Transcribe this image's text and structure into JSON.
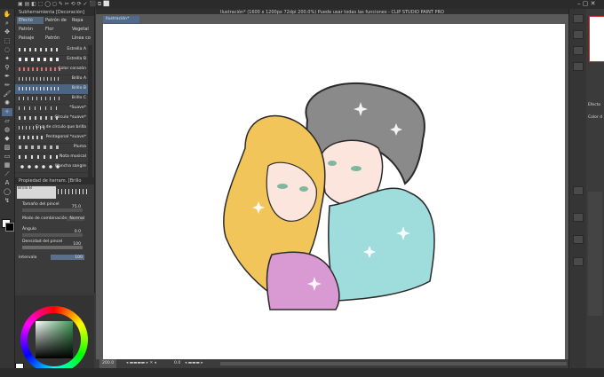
{
  "window": {
    "title": "Ilustración* (1600 x 1200px 72dpi 200.0%)  Puede usar todas las funciones - CLIP STUDIO PAINT PRO",
    "document_tab": "Ilustración*"
  },
  "sub_tool_panel": {
    "title": "Subherramienta [Decoración]",
    "tabs": [
      "Efecto",
      "Patrón de",
      "Ropa",
      "Patrón",
      "Flor",
      "Vegetal",
      "Paisaje",
      "Patrón",
      "Línea co"
    ],
    "brushes": [
      {
        "name": "Estrella A",
        "selected": false
      },
      {
        "name": "Estrella B",
        "selected": false
      },
      {
        "name": "Color corazón",
        "selected": false
      },
      {
        "name": "Brillo A",
        "selected": false
      },
      {
        "name": "Brillo B",
        "selected": true
      },
      {
        "name": "Brillo C",
        "selected": false
      },
      {
        "name": "*Suave*",
        "selected": false
      },
      {
        "name": "Círculo *suave*",
        "selected": false
      },
      {
        "name": "Cruz de círculo que brilla",
        "selected": false
      },
      {
        "name": "Pentagonal *suave*",
        "selected": false
      },
      {
        "name": "Pluma",
        "selected": false
      },
      {
        "name": "Nota musical",
        "selected": false
      },
      {
        "name": "Mancha sangre",
        "selected": false
      }
    ]
  },
  "tool_property": {
    "title": "Propiedad de herram. [Brillo",
    "preview_label": "Brillo B",
    "brush_size_label": "Tamaño del pincel",
    "brush_size_value": "75.0",
    "blend_mode_label": "Modo de combinación",
    "blend_mode_value": "Normal",
    "angle_label": "Ángulo",
    "angle_value": "0.0",
    "density_label": "Densidad del pincel",
    "density_value": "100",
    "interval_label": "Intervalo",
    "interval_value": "100"
  },
  "status": {
    "zoom": "200.0",
    "rotation": "0.0"
  },
  "right_panel": {
    "label_effect": "Efecto",
    "label_color": "Color d"
  },
  "colors": {
    "accent": "#4f6a8c",
    "main_color": "#ffffff",
    "sub_color": "#000000",
    "picker_green": "#3f9a58"
  },
  "icons": [
    "brush-icon",
    "pen-icon",
    "eraser-icon",
    "fill-icon",
    "move-icon",
    "zoom-icon",
    "hand-icon",
    "text-icon",
    "eyedropper-icon",
    "gradient-icon"
  ]
}
